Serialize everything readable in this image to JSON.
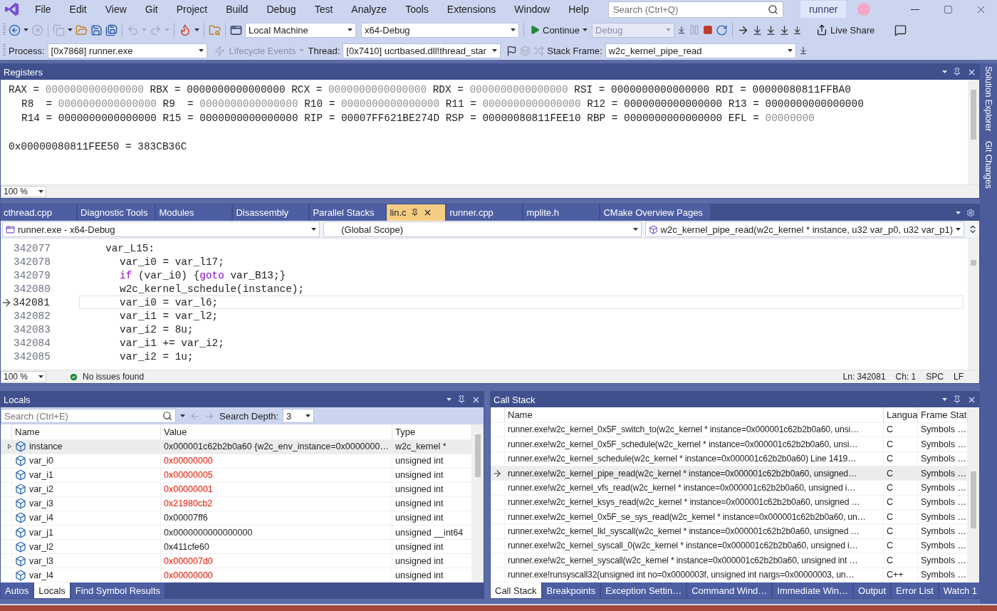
{
  "app": {
    "title": "runner"
  },
  "menu": [
    "File",
    "Edit",
    "View",
    "Git",
    "Project",
    "Build",
    "Debug",
    "Test",
    "Analyze",
    "Tools",
    "Extensions",
    "Window",
    "Help"
  ],
  "search": {
    "placeholder": "Search (Ctrl+Q)"
  },
  "toolbar": {
    "target": "Local Machine",
    "config": "x64-Debug",
    "continue": "Continue",
    "solution_config": "Debug",
    "live_share": "Live Share"
  },
  "debug_location": {
    "process_label": "Process:",
    "process": "[0x7868] runner.exe",
    "lifecycle": "Lifecycle Events",
    "thread_label": "Thread:",
    "thread": "[0x7410] ucrtbased.dll!thread_star",
    "stack_frame_label": "Stack Frame:",
    "stack_frame": "w2c_kernel_pipe_read"
  },
  "registers": {
    "title": "Registers",
    "rows": [
      [
        {
          "label": "RAX =",
          "value": "0000000000000000",
          "dim": true
        },
        {
          "label": "RBX =",
          "value": "0000000000000000",
          "dim": false
        },
        {
          "label": "RCX =",
          "value": "0000000000000000",
          "dim": true
        },
        {
          "label": "RDX =",
          "value": "0000000000000000",
          "dim": true
        },
        {
          "label": "RSI =",
          "value": "0000000000000000",
          "dim": false
        },
        {
          "label": "RDI =",
          "value": "00000080811FFBA0",
          "dim": false
        }
      ],
      [
        {
          "label": "R8  =",
          "value": "0000000000000000",
          "dim": true
        },
        {
          "label": "R9  =",
          "value": "0000000000000000",
          "dim": true
        },
        {
          "label": "R10 =",
          "value": "0000000000000000",
          "dim": true
        },
        {
          "label": "R11 =",
          "value": "0000000000000000",
          "dim": true
        },
        {
          "label": "R12 =",
          "value": "0000000000000000",
          "dim": false
        },
        {
          "label": "R13 =",
          "value": "0000000000000000",
          "dim": false
        }
      ],
      [
        {
          "label": "R14 =",
          "value": "0000000000000000",
          "dim": false
        },
        {
          "label": "R15 =",
          "value": "0000000000000000",
          "dim": false
        },
        {
          "label": "RIP =",
          "value": "00007FF621BE274D",
          "dim": false
        },
        {
          "label": "RSP =",
          "value": "00000080811FEE10",
          "dim": false
        },
        {
          "label": "RBP =",
          "value": "0000000000000000",
          "dim": false
        },
        {
          "label": "EFL =",
          "value": "00000000",
          "dim": true
        }
      ]
    ],
    "memory": "0x00000080811FEE50 = 383CB36C",
    "zoom": "100 %"
  },
  "side_tabs": [
    {
      "label": "Solution Explorer"
    },
    {
      "label": "Git Changes"
    }
  ],
  "editor": {
    "tabs": [
      {
        "label": "cthread.cpp",
        "selected": false
      },
      {
        "label": "Diagnostic Tools",
        "selected": false
      },
      {
        "label": "Modules",
        "selected": false
      },
      {
        "label": "Disassembly",
        "selected": false
      },
      {
        "label": "Parallel Stacks",
        "selected": false
      },
      {
        "label": "lin.c",
        "selected": true
      },
      {
        "label": "runner.cpp",
        "selected": false
      },
      {
        "label": "mplite.h",
        "selected": false
      },
      {
        "label": "CMake Overview Pages",
        "selected": false
      }
    ],
    "project": "runner.exe - x64-Debug",
    "scope": "(Global Scope)",
    "member": "w2c_kernel_pipe_read(w2c_kernel * instance, u32 var_p0, u32 var_p1)",
    "lines": [
      {
        "number": "342077",
        "kind": "label",
        "current": false,
        "tokens": [
          {
            "text": "var_L15:",
            "kind": "plain"
          }
        ]
      },
      {
        "number": "342078",
        "kind": "statement",
        "current": false,
        "tokens": [
          {
            "text": "var_i0 = var_l17;",
            "kind": "plain"
          }
        ]
      },
      {
        "number": "342079",
        "kind": "statement",
        "current": false,
        "tokens": [
          {
            "text": "if",
            "kind": "keyword"
          },
          {
            "text": " (var_i0) {",
            "kind": "plain"
          },
          {
            "text": "goto",
            "kind": "keyword"
          },
          {
            "text": " var_B13;}",
            "kind": "plain"
          }
        ]
      },
      {
        "number": "342080",
        "kind": "statement",
        "current": false,
        "tokens": [
          {
            "text": "w2c_kernel_schedule(instance);",
            "kind": "plain"
          }
        ]
      },
      {
        "number": "342081",
        "kind": "statement",
        "current": true,
        "tokens": [
          {
            "text": "var_i0 = var_l6;",
            "kind": "plain"
          }
        ]
      },
      {
        "number": "342082",
        "kind": "statement",
        "current": false,
        "tokens": [
          {
            "text": "var_i1 = var_l2;",
            "kind": "plain"
          }
        ]
      },
      {
        "number": "342083",
        "kind": "statement",
        "current": false,
        "tokens": [
          {
            "text": "var_i2 = 8u;",
            "kind": "plain"
          }
        ]
      },
      {
        "number": "342084",
        "kind": "statement",
        "current": false,
        "tokens": [
          {
            "text": "var_i1 += var_i2;",
            "kind": "plain"
          }
        ]
      },
      {
        "number": "342085",
        "kind": "statement",
        "current": false,
        "tokens": [
          {
            "text": "var_i2 = 1u;",
            "kind": "plain"
          }
        ]
      }
    ],
    "zoom": "100 %",
    "issues": "No issues found",
    "ln": "Ln: 342081",
    "ch": "Ch: 1",
    "spc": "SPC",
    "lf": "LF"
  },
  "locals": {
    "title": "Locals",
    "search_placeholder": "Search (Ctrl+E)",
    "depth_label": "Search Depth:",
    "depth": "3",
    "columns": [
      "Name",
      "Value",
      "Type"
    ],
    "rows": [
      {
        "name": "instance",
        "value": "0x000001c62b2b0a60 {w2c_env_instance=0x0000000…",
        "type": "w2c_kernel *",
        "changed": false,
        "expandable": true,
        "selected": true
      },
      {
        "name": "var_i0",
        "value": "0x00000000",
        "type": "unsigned int",
        "changed": true,
        "expandable": false,
        "selected": false
      },
      {
        "name": "var_i1",
        "value": "0x00000005",
        "type": "unsigned int",
        "changed": true,
        "expandable": false,
        "selected": false
      },
      {
        "name": "var_i2",
        "value": "0x00000001",
        "type": "unsigned int",
        "changed": true,
        "expandable": false,
        "selected": false
      },
      {
        "name": "var_i3",
        "value": "0x21980cb2",
        "type": "unsigned int",
        "changed": true,
        "expandable": false,
        "selected": false
      },
      {
        "name": "var_i4",
        "value": "0x00007ff6",
        "type": "unsigned int",
        "changed": false,
        "expandable": false,
        "selected": false
      },
      {
        "name": "var_j1",
        "value": "0x0000000000000000",
        "type": "unsigned __int64",
        "changed": false,
        "expandable": false,
        "selected": false
      },
      {
        "name": "var_l2",
        "value": "0x411cfe60",
        "type": "unsigned int",
        "changed": false,
        "expandable": false,
        "selected": false
      },
      {
        "name": "var_l3",
        "value": "0x000007d0",
        "type": "unsigned int",
        "changed": true,
        "expandable": false,
        "selected": false
      },
      {
        "name": "var_l4",
        "value": "0x00000000",
        "type": "unsigned int",
        "changed": true,
        "expandable": false,
        "selected": false
      }
    ],
    "tabs": [
      {
        "label": "Autos",
        "selected": false
      },
      {
        "label": "Locals",
        "selected": true
      },
      {
        "label": "Find Symbol Results",
        "selected": false
      }
    ]
  },
  "call_stack": {
    "title": "Call Stack",
    "columns": [
      "Name",
      "Langua",
      "Frame Stat"
    ],
    "rows": [
      {
        "name": "runner.exe!w2c_kernel_0x5F_switch_to(w2c_kernel * instance=0x000001c62b2b0a60, unsi…",
        "language": "C",
        "status": "Symbols …",
        "current": false
      },
      {
        "name": "runner.exe!w2c_kernel_0x5F_schedule(w2c_kernel * instance=0x000001c62b2b0a60, unsi…",
        "language": "C",
        "status": "Symbols …",
        "current": false
      },
      {
        "name": "runner.exe!w2c_kernel_schedule(w2c_kernel * instance=0x000001c62b2b0a60) Line 1419…",
        "language": "C",
        "status": "Symbols …",
        "current": false
      },
      {
        "name": "runner.exe!w2c_kernel_pipe_read(w2c_kernel * instance=0x000001c62b2b0a60, unsigned…",
        "language": "C",
        "status": "Symbols …",
        "current": true
      },
      {
        "name": "runner.exe!w2c_kernel_vfs_read(w2c_kernel * instance=0x000001c62b2b0a60, unsigned i…",
        "language": "C",
        "status": "Symbols …",
        "current": false
      },
      {
        "name": "runner.exe!w2c_kernel_ksys_read(w2c_kernel * instance=0x000001c62b2b0a60, unsigned …",
        "language": "C",
        "status": "Symbols …",
        "current": false
      },
      {
        "name": "runner.exe!w2c_kernel_0x5F_se_sys_read(w2c_kernel * instance=0x000001c62b2b0a60, un…",
        "language": "C",
        "status": "Symbols …",
        "current": false
      },
      {
        "name": "runner.exe!w2c_kernel_lkl_syscall(w2c_kernel * instance=0x000001c62b2b0a60, unsigned …",
        "language": "C",
        "status": "Symbols …",
        "current": false
      },
      {
        "name": "runner.exe!w2c_kernel_syscall_0(w2c_kernel * instance=0x000001c62b2b0a60, unsigned i…",
        "language": "C",
        "status": "Symbols …",
        "current": false
      },
      {
        "name": "runner.exe!w2c_kernel_syscall(w2c_kernel * instance=0x000001c62b2b0a60, unsigned int …",
        "language": "C",
        "status": "Symbols …",
        "current": false
      },
      {
        "name": "runner.exe!runsyscall32(unsigned int no=0x0000003f, unsigned int nargs=0x00000003, un…",
        "language": "C++",
        "status": "Symbols …",
        "current": false
      }
    ],
    "tabs": [
      {
        "label": "Call Stack",
        "selected": true
      },
      {
        "label": "Breakpoints",
        "selected": false
      },
      {
        "label": "Exception Settin…",
        "selected": false
      },
      {
        "label": "Command Wind…",
        "selected": false
      },
      {
        "label": "Immediate Win…",
        "selected": false
      },
      {
        "label": "Output",
        "selected": false
      },
      {
        "label": "Error List",
        "selected": false
      },
      {
        "label": "Watch 1",
        "selected": false
      }
    ]
  }
}
